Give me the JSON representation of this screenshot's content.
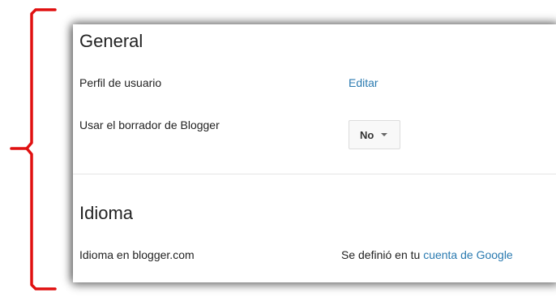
{
  "general": {
    "title": "General",
    "profile_label": "Perfil de usuario",
    "profile_action": "Editar",
    "draft_label": "Usar el borrador de Blogger",
    "draft_value": "No"
  },
  "language": {
    "title": "Idioma",
    "label": "Idioma en blogger.com",
    "value_prefix": "Se definió en tu",
    "value_link": "cuenta de Google"
  },
  "colors": {
    "bracket": "#e01010",
    "link": "#2a7ab0"
  }
}
